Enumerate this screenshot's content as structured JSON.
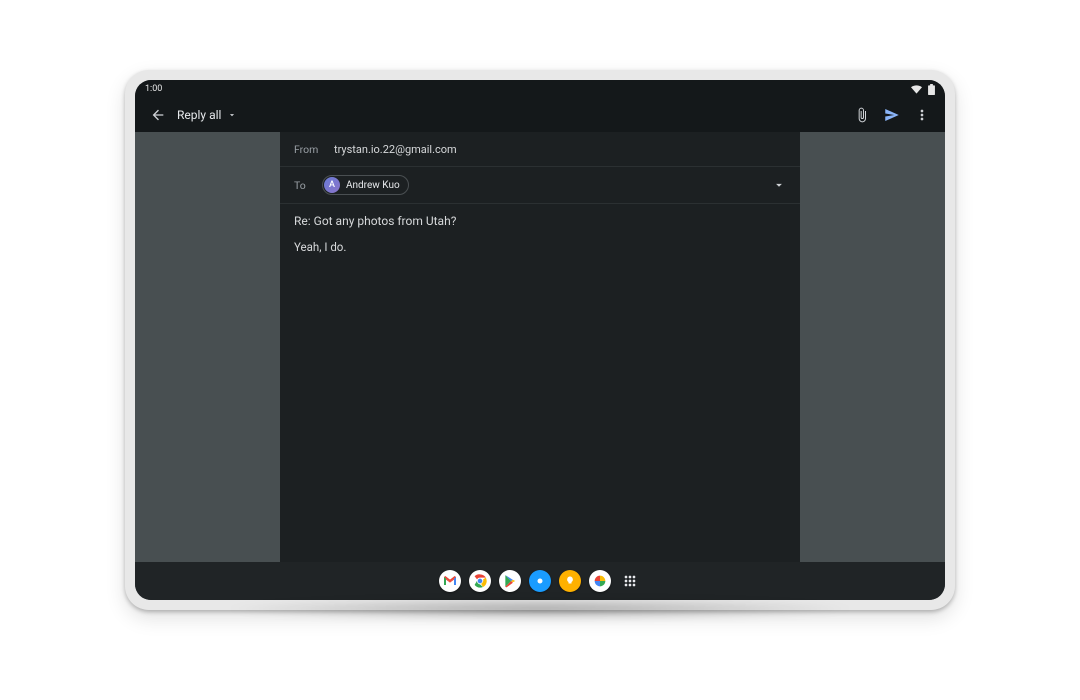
{
  "status": {
    "time": "1:00"
  },
  "header": {
    "title": "Reply all"
  },
  "compose": {
    "from_label": "From",
    "from_value": "trystan.io.22@gmail.com",
    "to_label": "To",
    "recipient": {
      "initial": "A",
      "name": "Andrew Kuo"
    },
    "subject": "Re: Got any photos from Utah?",
    "body": "Yeah, I do.",
    "quoted_toggle": "•••"
  }
}
